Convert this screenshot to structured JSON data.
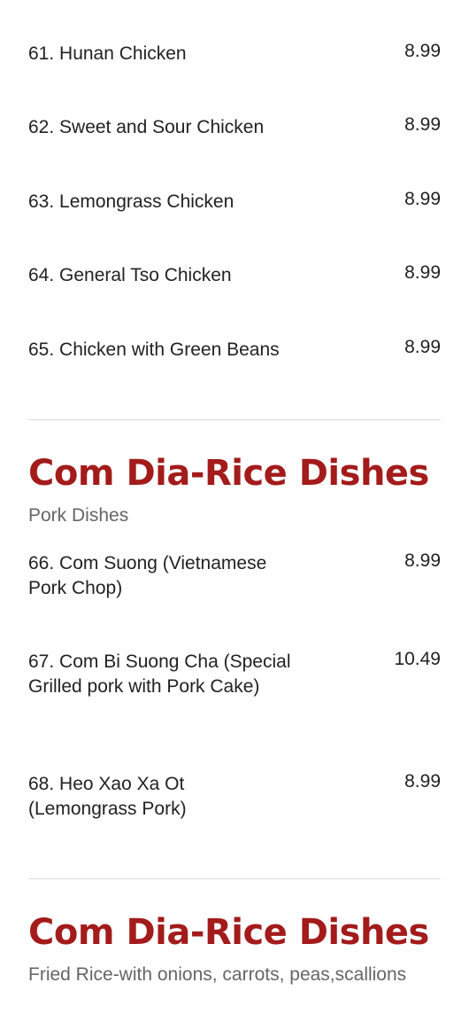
{
  "accent_color": "#a31b1b",
  "top_items": [
    {
      "name": "61. Hunan Chicken",
      "price": "8.99"
    },
    {
      "name": "62. Sweet and Sour Chicken",
      "price": "8.99"
    },
    {
      "name": "63. Lemongrass Chicken",
      "price": "8.99"
    },
    {
      "name": "64. General Tso Chicken",
      "price": "8.99"
    },
    {
      "name": "65. Chicken with Green Beans",
      "price": "8.99"
    }
  ],
  "sections": [
    {
      "title": "Com Dia-Rice Dishes",
      "subtitle": "Pork Dishes",
      "items": [
        {
          "name": "66. Com Suong (Vietnamese Pork Chop)",
          "price": "8.99"
        },
        {
          "name": "67. Com Bi Suong Cha (Special Grilled pork with Pork Cake)",
          "price": "10.49"
        },
        {
          "name": "68. Heo Xao Xa Ot (Lemongrass Pork)",
          "price": "8.99"
        }
      ]
    },
    {
      "title": "Com Dia-Rice Dishes",
      "subtitle": "Fried Rice-with onions, carrots, peas,scallions",
      "items": []
    }
  ]
}
